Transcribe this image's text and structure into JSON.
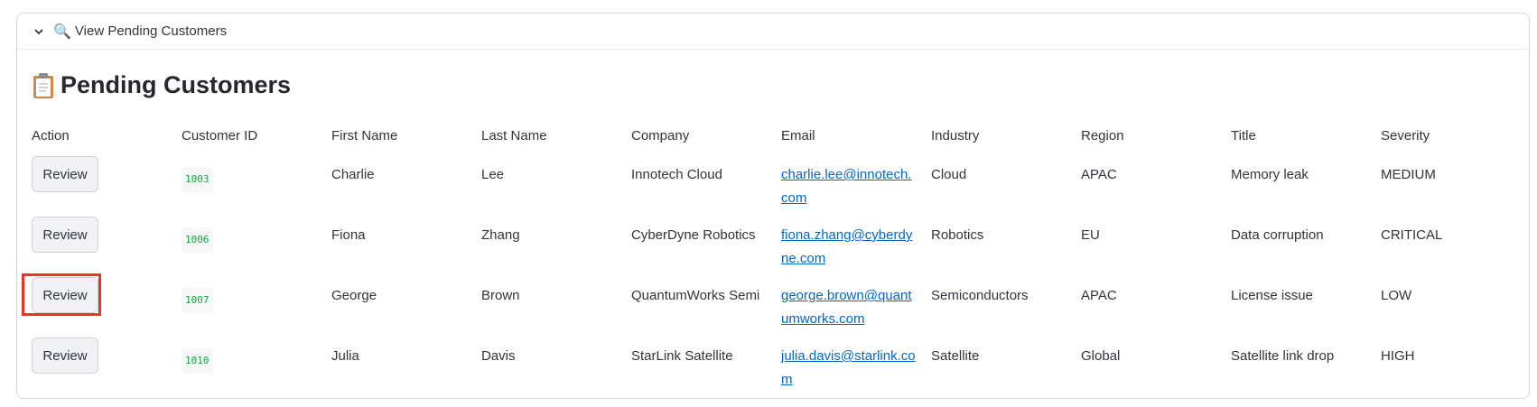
{
  "expander": {
    "label": "View Pending Customers",
    "chevron_icon": "chevron-down-icon",
    "magnifier_icon": "magnifying-glass-icon"
  },
  "section": {
    "title": "Pending Customers",
    "icon": "clipboard-icon"
  },
  "table": {
    "headers": [
      "Action",
      "Customer ID",
      "First Name",
      "Last Name",
      "Company",
      "Email",
      "Industry",
      "Region",
      "Title",
      "Severity"
    ],
    "rows": [
      {
        "action": "Review",
        "id": "1003",
        "first": "Charlie",
        "last": "Lee",
        "company": "Innotech Cloud",
        "email": "charlie.lee@innotech.com",
        "industry": "Cloud",
        "region": "APAC",
        "title": "Memory leak",
        "severity": "MEDIUM"
      },
      {
        "action": "Review",
        "id": "1006",
        "first": "Fiona",
        "last": "Zhang",
        "company": "CyberDyne Robotics",
        "email": "fiona.zhang@cyberdyne.com",
        "industry": "Robotics",
        "region": "EU",
        "title": "Data corruption",
        "severity": "CRITICAL"
      },
      {
        "action": "Review",
        "id": "1007",
        "first": "George",
        "last": "Brown",
        "company": "QuantumWorks Semi",
        "email": "george.brown@quantumworks.com",
        "industry": "Semiconductors",
        "region": "APAC",
        "title": "License issue",
        "severity": "LOW"
      },
      {
        "action": "Review",
        "id": "1010",
        "first": "Julia",
        "last": "Davis",
        "company": "StarLink Satellite",
        "email": "julia.davis@starlink.com",
        "industry": "Satellite",
        "region": "Global",
        "title": "Satellite link drop",
        "severity": "HIGH"
      }
    ]
  },
  "colors": {
    "accent_link": "#0068c9",
    "code_green": "#09ab3b",
    "highlight_red": "#e8352a"
  }
}
